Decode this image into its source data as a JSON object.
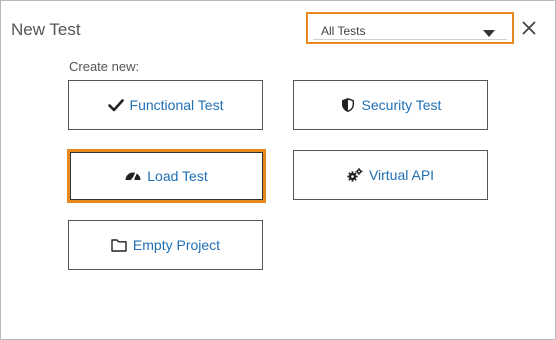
{
  "dialog": {
    "title": "New Test",
    "filter": {
      "selected": "All Tests"
    },
    "create_label": "Create new:",
    "tiles": [
      {
        "label": "Functional Test",
        "icon": "checkmark-icon"
      },
      {
        "label": "Security Test",
        "icon": "shield-icon"
      },
      {
        "label": "Load Test",
        "icon": "gauge-icon",
        "selected": true
      },
      {
        "label": "Virtual API",
        "icon": "gears-icon"
      },
      {
        "label": "Empty Project",
        "icon": "folder-icon"
      }
    ]
  },
  "colors": {
    "accent": "#e8891d",
    "link": "#1f6fb5",
    "border": "#555555"
  }
}
